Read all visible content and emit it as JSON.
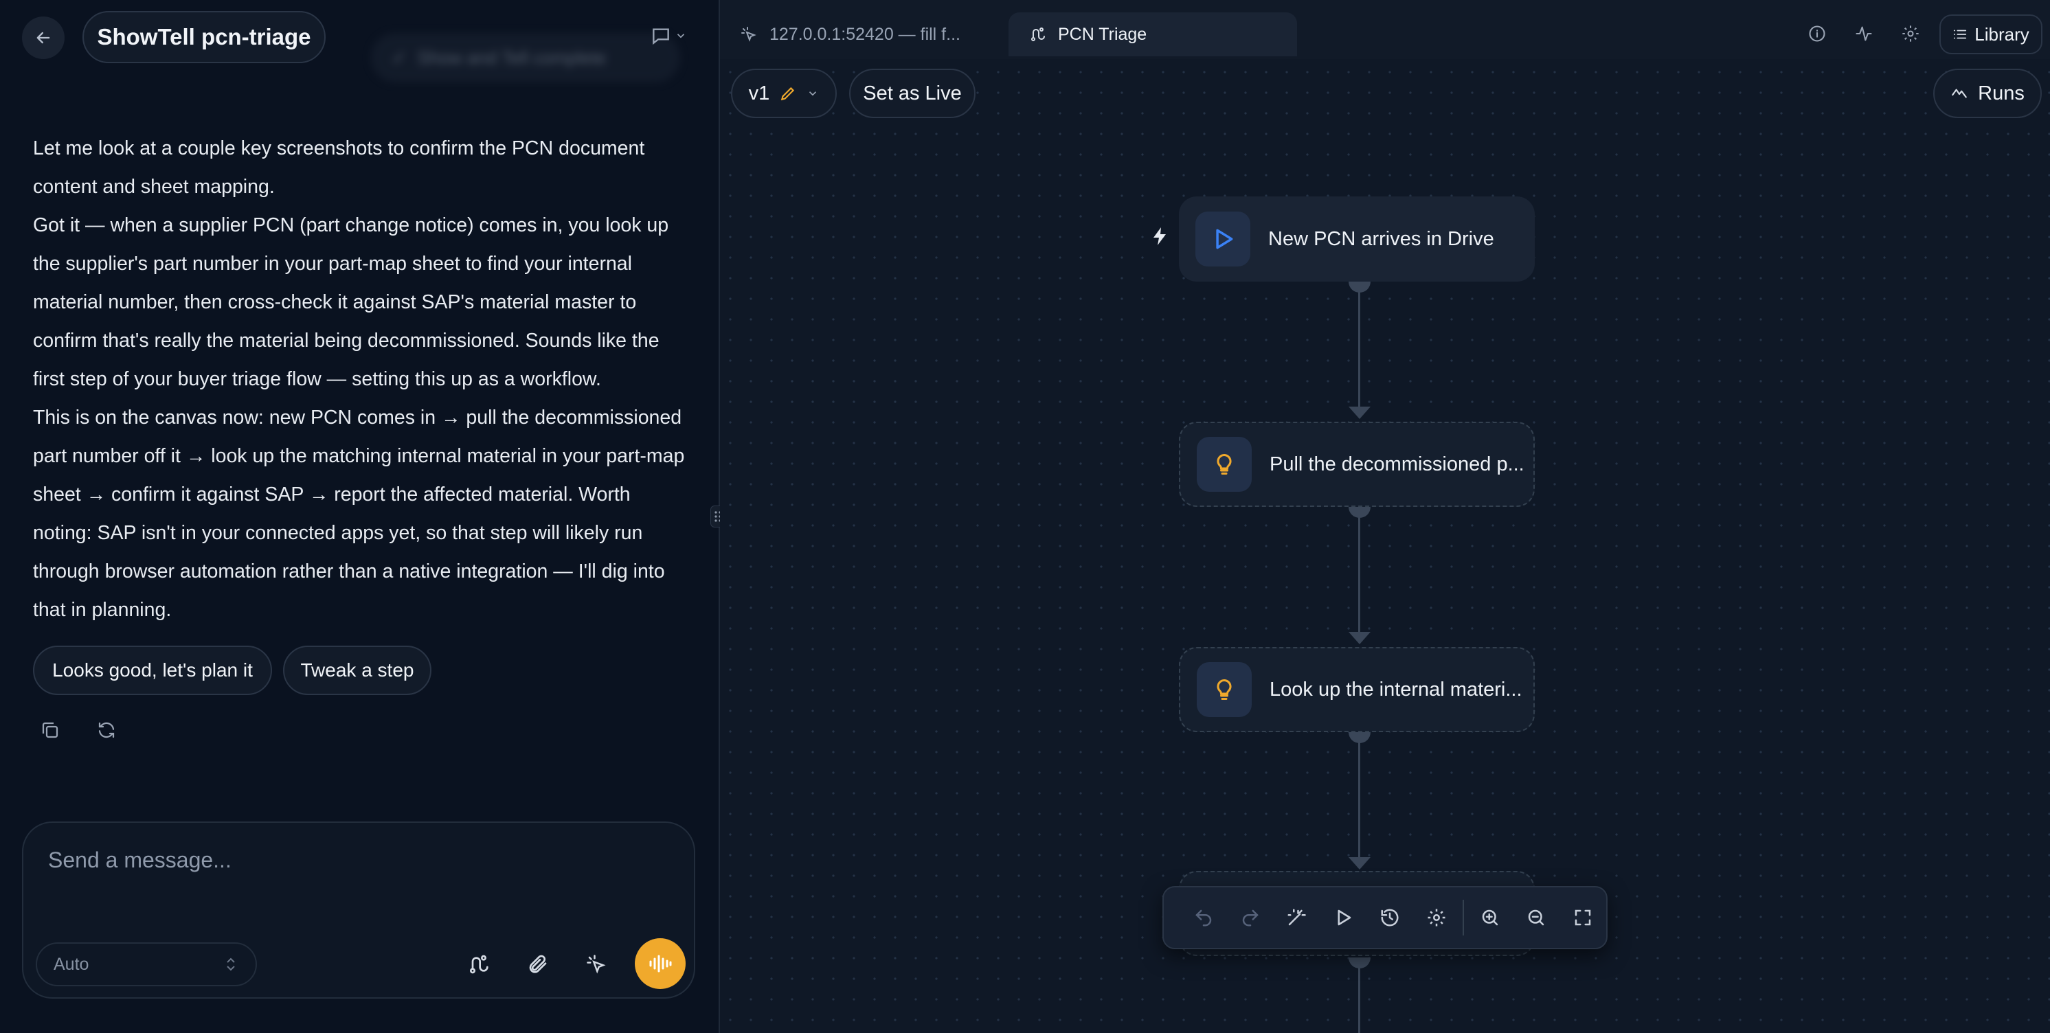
{
  "chat": {
    "title": "ShowTell pcn-triage",
    "toast": "Show and Tell complete",
    "messages": [
      "Let me look at a couple key screenshots to confirm the PCN document content and sheet mapping.",
      "Got it — when a supplier PCN (part change notice) comes in, you look up the supplier's part number in your part-map sheet to find your internal material number, then cross-check it against SAP's material master to confirm that's really the material being decommissioned. Sounds like the first step of your buyer triage flow — setting this up as a workflow.",
      "This is on the canvas now: new PCN comes in → pull the decommissioned part number off it → look up the matching internal material in your part-map sheet → confirm it against SAP → report the affected material. Worth noting: SAP isn't in your connected apps yet, so that step will likely run through browser automation rather than a native integration — I'll dig into that in planning."
    ],
    "suggestions": [
      "Looks good, let's plan it",
      "Tweak a step"
    ],
    "composer": {
      "placeholder": "Send a message...",
      "model": "Auto"
    }
  },
  "canvas": {
    "tabs": [
      {
        "label": "127.0.0.1:52420 — fill f..."
      },
      {
        "label": "PCN Triage"
      }
    ],
    "header": {
      "library_label": "Library"
    },
    "version_label": "v1",
    "set_live_label": "Set as Live",
    "runs_label": "Runs",
    "nodes": [
      {
        "label": "New PCN arrives in Drive",
        "kind": "trigger"
      },
      {
        "label": "Pull the decommissioned p...",
        "kind": "step"
      },
      {
        "label": "Look up the internal materi...",
        "kind": "step"
      }
    ]
  },
  "colors": {
    "accent": "#f0a92c",
    "trigger_blue": "#3b82f6",
    "background": "#0b1320"
  }
}
